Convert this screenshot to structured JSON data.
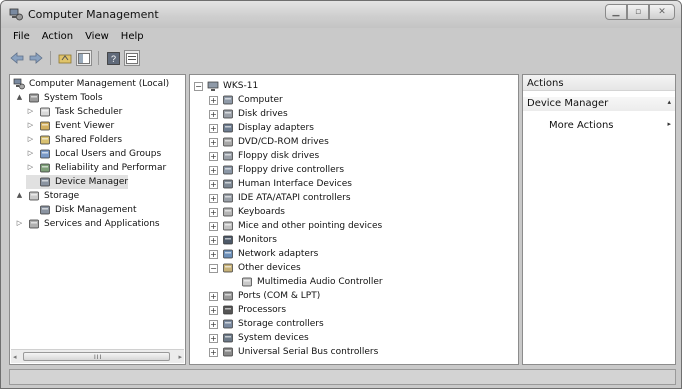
{
  "window": {
    "title": "Computer Management"
  },
  "menu": [
    "File",
    "Action",
    "View",
    "Help"
  ],
  "toolbar": {
    "icons": [
      "back-arrow-icon",
      "forward-arrow-icon",
      "up-folder-icon",
      "show-hide-tree-icon",
      "help-icon",
      "properties-icon"
    ]
  },
  "left_tree": {
    "root": "Computer Management (Local)",
    "items": [
      {
        "label": "System Tools",
        "level": 1,
        "expander": "▲",
        "icon": "tools-icon"
      },
      {
        "label": "Task Scheduler",
        "level": 2,
        "expander": "▷",
        "icon": "clock-icon"
      },
      {
        "label": "Event Viewer",
        "level": 2,
        "expander": "▷",
        "icon": "event-viewer-icon"
      },
      {
        "label": "Shared Folders",
        "level": 2,
        "expander": "▷",
        "icon": "shared-folder-icon"
      },
      {
        "label": "Local Users and Groups",
        "level": 2,
        "expander": "▷",
        "icon": "users-icon"
      },
      {
        "label": "Reliability and Performar",
        "level": 2,
        "expander": "▷",
        "icon": "performance-icon"
      },
      {
        "label": "Device Manager",
        "level": 2,
        "expander": "",
        "icon": "device-manager-icon"
      },
      {
        "label": "Storage",
        "level": 1,
        "expander": "▲",
        "icon": "storage-icon"
      },
      {
        "label": "Disk Management",
        "level": 2,
        "expander": "",
        "icon": "disk-management-icon"
      },
      {
        "label": "Services and Applications",
        "level": 1,
        "expander": "▷",
        "icon": "services-icon"
      }
    ]
  },
  "device_tree": {
    "root": "WKS-11",
    "items": [
      {
        "label": "Computer",
        "expander": "⊞",
        "icon": "computer-icon",
        "child": false
      },
      {
        "label": "Disk drives",
        "expander": "⊞",
        "icon": "disk-drive-icon",
        "child": false
      },
      {
        "label": "Display adapters",
        "expander": "⊞",
        "icon": "display-adapter-icon",
        "child": false
      },
      {
        "label": "DVD/CD-ROM drives",
        "expander": "⊞",
        "icon": "dvd-drive-icon",
        "child": false
      },
      {
        "label": "Floppy disk drives",
        "expander": "⊞",
        "icon": "floppy-drive-icon",
        "child": false
      },
      {
        "label": "Floppy drive controllers",
        "expander": "⊞",
        "icon": "floppy-controller-icon",
        "child": false
      },
      {
        "label": "Human Interface Devices",
        "expander": "⊞",
        "icon": "hid-icon",
        "child": false
      },
      {
        "label": "IDE ATA/ATAPI controllers",
        "expander": "⊞",
        "icon": "ide-controller-icon",
        "child": false
      },
      {
        "label": "Keyboards",
        "expander": "⊞",
        "icon": "keyboard-icon",
        "child": false
      },
      {
        "label": "Mice and other pointing devices",
        "expander": "⊞",
        "icon": "mouse-icon",
        "child": false
      },
      {
        "label": "Monitors",
        "expander": "⊞",
        "icon": "monitor-icon",
        "child": false
      },
      {
        "label": "Network adapters",
        "expander": "⊞",
        "icon": "network-adapter-icon",
        "child": false
      },
      {
        "label": "Other devices",
        "expander": "⊟",
        "icon": "other-devices-icon",
        "child": false
      },
      {
        "label": "Multimedia Audio Controller",
        "expander": "",
        "icon": "unknown-device-icon",
        "child": true
      },
      {
        "label": "Ports (COM & LPT)",
        "expander": "⊞",
        "icon": "port-icon",
        "child": false
      },
      {
        "label": "Processors",
        "expander": "⊞",
        "icon": "processor-icon",
        "child": false
      },
      {
        "label": "Storage controllers",
        "expander": "⊞",
        "icon": "storage-controller-icon",
        "child": false
      },
      {
        "label": "System devices",
        "expander": "⊞",
        "icon": "system-devices-icon",
        "child": false
      },
      {
        "label": "Universal Serial Bus controllers",
        "expander": "⊞",
        "icon": "usb-icon",
        "child": false
      }
    ]
  },
  "actions": {
    "header": "Actions",
    "section": "Device Manager",
    "more": "More Actions"
  },
  "scrollbar": {
    "grip": "III"
  }
}
